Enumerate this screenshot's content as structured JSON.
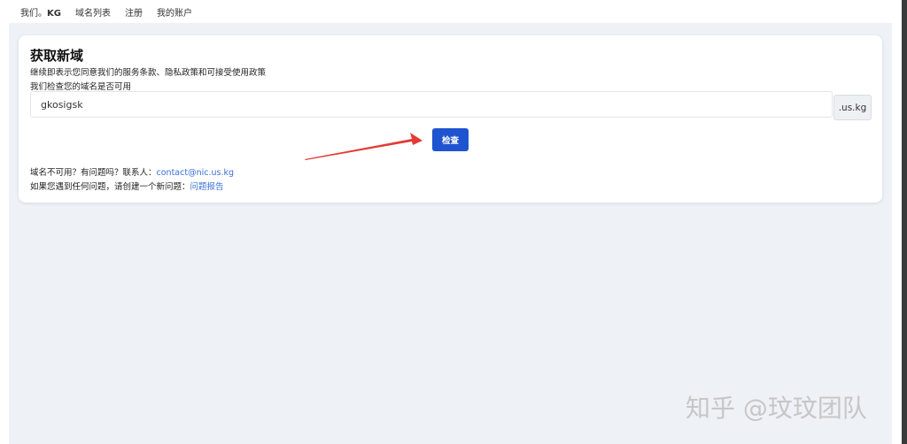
{
  "navbar": {
    "items": [
      {
        "label": "我们。",
        "bold": "KG"
      },
      {
        "label": "域名列表"
      },
      {
        "label": "注册"
      },
      {
        "label": "我的账户"
      }
    ]
  },
  "card": {
    "title": "获取新域",
    "terms_text": "继续即表示您同意我们的服务条款、隐私政策和可接受使用政策",
    "check_hint": "我们检查您的域名是否可用",
    "input_value": "gkosigsk",
    "suffix": ".us.kg",
    "check_button": "检查",
    "contact_prefix": "域名不可用？有问题吗？联系人：",
    "contact_email": "contact@nic.us.kg",
    "issue_prefix": "如果您遇到任何问题，请创建一个新问题：",
    "issue_link": "问题报告"
  },
  "watermark": "知乎 @玟玟团队",
  "colors": {
    "primary_button": "#1e54d0",
    "link": "#3a6fd8",
    "annotation_arrow": "#e53935",
    "page_background": "#eef2f6"
  }
}
